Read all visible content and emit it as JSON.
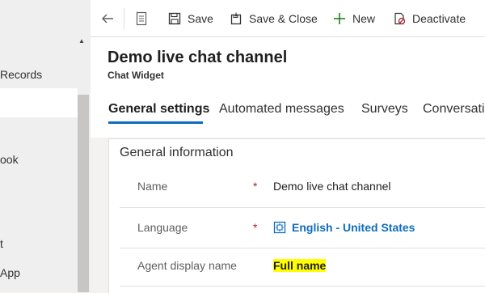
{
  "sidebar": {
    "items": [
      "Records",
      "ook",
      "t",
      "App"
    ]
  },
  "commandbar": {
    "save": "Save",
    "save_close": "Save & Close",
    "new": "New",
    "deactivate": "Deactivate"
  },
  "header": {
    "title": "Demo live chat channel",
    "entity": "Chat Widget",
    "tabs": [
      "General settings",
      "Automated messages",
      "Surveys",
      "Conversatio"
    ]
  },
  "section": {
    "title": "General information",
    "fields": [
      {
        "label": "Name",
        "required": "*",
        "value": "Demo live chat channel"
      },
      {
        "label": "Language",
        "required": "*",
        "value": "English - United States"
      },
      {
        "label": "Agent display name",
        "required": "",
        "value": "Full name"
      }
    ]
  },
  "colors": {
    "accent": "#0f6cbd",
    "required": "#a4262c",
    "highlight": "#ffff00"
  }
}
